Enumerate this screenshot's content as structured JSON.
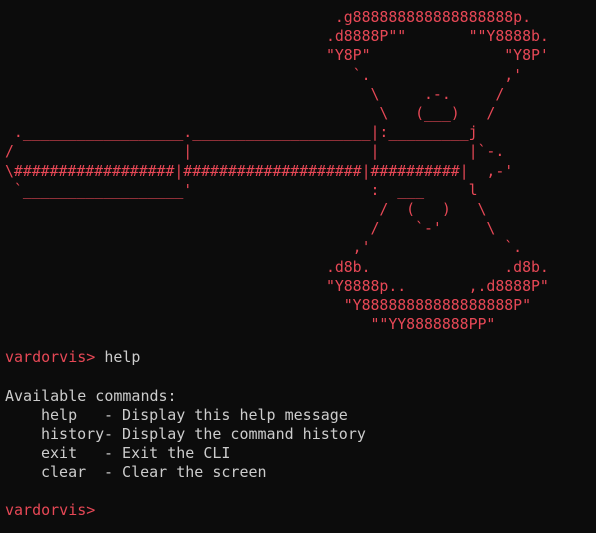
{
  "ascii_art": "                                     .g888888888888888888p.\n                                    .d8888P\"\"       \"\"Y8888b.\n                                    \"Y8P\"               \"Y8P'\n                                       `.               ,'\n                                         \\     .-.     /\n                                          \\   (___)   /\n .__________________.____________________|:_________j\n/                   |                    |          |`-.\n\\##################|####################|##########|  ,-'\n `__________________'                    :  ___     l\n                                          /  (   )   \\\n                                         /    `-'     \\\n                                       ,'               `.\n                                    .d8b.               .d8b.\n                                    \"Y8888p..       ,.d8888P\"\n                                      \"Y88888888888888888P\"\n                                         \"\"YY8888888PP\"",
  "session": {
    "prompt": "vardorvis>",
    "entered_command": "help",
    "output_header": "Available commands:",
    "commands": [
      {
        "name": "help",
        "description": "- Display this help message"
      },
      {
        "name": "history",
        "description": "- Display the command history"
      },
      {
        "name": "exit",
        "description": "- Exit the CLI"
      },
      {
        "name": "clear",
        "description": "- Clear the screen"
      }
    ],
    "final_prompt": "vardorvis>"
  },
  "colors": {
    "background": "#0c0c0c",
    "prompt": "#e74856",
    "text": "#cccccc"
  }
}
